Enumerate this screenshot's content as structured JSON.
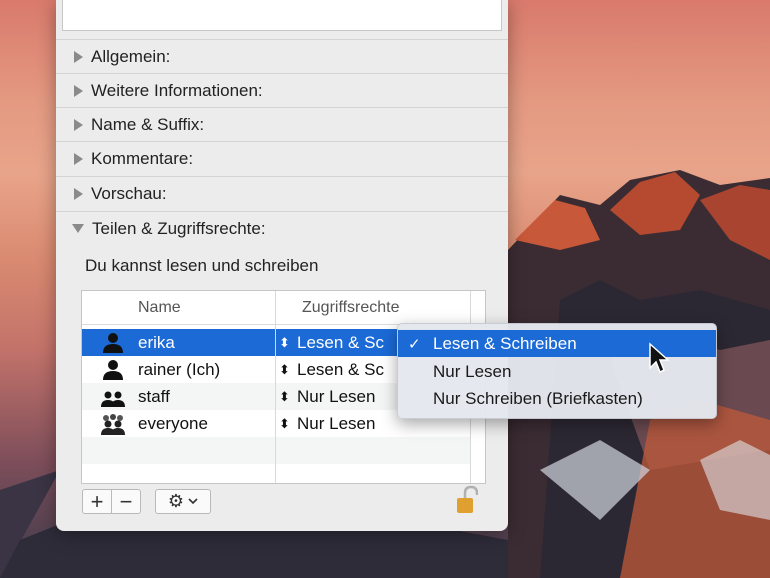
{
  "sections": [
    {
      "label": "Allgemein:",
      "expanded": false
    },
    {
      "label": "Weitere Informationen:",
      "expanded": false
    },
    {
      "label": "Name & Suffix:",
      "expanded": false
    },
    {
      "label": "Kommentare:",
      "expanded": false
    },
    {
      "label": "Vorschau:",
      "expanded": false
    },
    {
      "label": "Teilen & Zugriffsrechte:",
      "expanded": true
    }
  ],
  "sharing": {
    "status": "Du kannst lesen und schreiben",
    "columns": {
      "name": "Name",
      "permissions": "Zugriffsrechte"
    },
    "rows": [
      {
        "name": "erika",
        "permission": "Lesen & Sc",
        "icon": "user-icon",
        "selected": true
      },
      {
        "name": "rainer (Ich)",
        "permission": "Lesen & Sc",
        "icon": "user-icon",
        "selected": false
      },
      {
        "name": "staff",
        "permission": "Nur Lesen",
        "icon": "group-icon",
        "selected": false
      },
      {
        "name": "everyone",
        "permission": "Nur Lesen",
        "icon": "everyone-icon",
        "selected": false
      }
    ],
    "buttons": {
      "add": "+",
      "remove": "−",
      "action": "⚙"
    }
  },
  "menu": {
    "items": [
      {
        "label": "Lesen & Schreiben",
        "checked": true
      },
      {
        "label": "Nur Lesen",
        "checked": false
      },
      {
        "label": "Nur Schreiben (Briefkasten)",
        "checked": false
      }
    ],
    "check_glyph": "✓"
  },
  "colors": {
    "selection": "#1b6ad6",
    "panel": "#ececec",
    "lock": "#e0a030"
  }
}
